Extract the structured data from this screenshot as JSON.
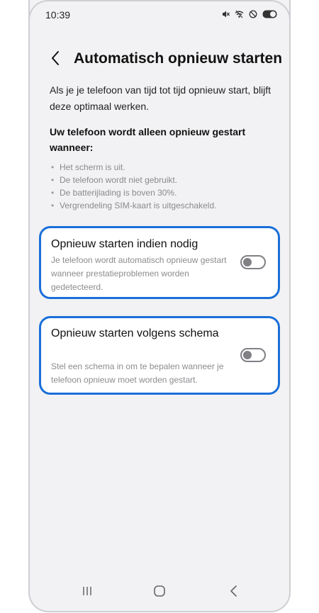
{
  "status_bar": {
    "time": "10:39",
    "icons": [
      "mute-icon",
      "wifi-off-icon",
      "do-not-disturb-icon",
      "battery-icon"
    ]
  },
  "header": {
    "back_icon": "chevron-left-icon",
    "title": "Automatisch opnieuw starten"
  },
  "intro_text": "Als je je telefoon van tijd tot tijd opnieuw start, blijft deze optimaal werken.",
  "conditions_heading": "Uw telefoon wordt alleen opnieuw gestart wanneer:",
  "conditions": [
    "Het scherm is uit.",
    "De telefoon wordt niet gebruikt.",
    "De batterijlading is boven 30%.",
    "Vergrendeling SIM-kaart is uitgeschakeld."
  ],
  "options": [
    {
      "title": "Opnieuw starten indien nodig",
      "description": "Je telefoon wordt automatisch opnieuw gestart wanneer prestatieproblemen worden gedetecteerd.",
      "enabled": false
    },
    {
      "title": "Opnieuw starten volgens schema",
      "description": "Stel een schema in om te bepalen wanneer je telefoon opnieuw moet worden gestart.",
      "enabled": false
    }
  ],
  "nav_bar": {
    "icons": [
      "recent-apps-icon",
      "home-icon",
      "back-icon"
    ]
  },
  "colors": {
    "highlight_border": "#1a6fd9",
    "background": "#f2f2f4",
    "toggle_off": "#808085",
    "secondary_text": "#8c8c90"
  }
}
